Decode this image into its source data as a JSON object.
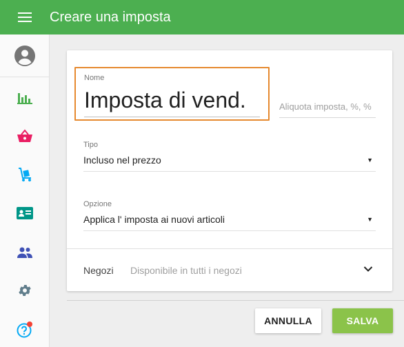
{
  "header": {
    "title": "Creare una imposta",
    "menu_icon": "menu-icon"
  },
  "sidebar": {
    "avatar_icon": "account-circle-icon",
    "items": [
      {
        "name": "reports",
        "icon": "bar-chart-icon",
        "color": "#4caf50"
      },
      {
        "name": "items",
        "icon": "basket-icon",
        "color": "#e91e63"
      },
      {
        "name": "inventory",
        "icon": "hand-truck-icon",
        "color": "#03a9f4"
      },
      {
        "name": "employees",
        "icon": "id-card-icon",
        "color": "#009688"
      },
      {
        "name": "customers",
        "icon": "people-icon",
        "color": "#3f51b5"
      },
      {
        "name": "settings",
        "icon": "gear-icon",
        "color": "#607d8b"
      },
      {
        "name": "help",
        "icon": "help-icon",
        "color": "#03a9f4",
        "badge_color": "#f44336"
      }
    ]
  },
  "form": {
    "name_label": "Nome",
    "name_value": "Imposta di vend.",
    "rate_placeholder": "Aliquota imposta, %, %",
    "type_label": "Tipo",
    "type_value": "Incluso nel prezzo",
    "option_label": "Opzione",
    "option_value": "Applica l' imposta ai nuovi articoli",
    "stores_label": "Negozi",
    "stores_value": "Disponibile in tutti i negozi"
  },
  "actions": {
    "cancel_label": "ANNULLA",
    "save_label": "SALVA"
  },
  "colors": {
    "accent": "#4caf50",
    "save": "#8bc34a",
    "focus": "#e6892e"
  }
}
